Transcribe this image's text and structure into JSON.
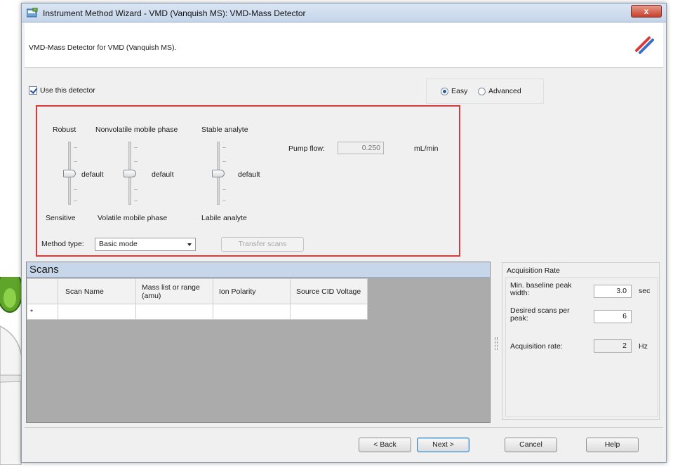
{
  "window": {
    "title": "Instrument Method Wizard - VMD (Vanquish MS): VMD-Mass Detector",
    "close_label": "x",
    "subtitle": "VMD-Mass Detector for VMD (Vanquish MS)."
  },
  "detector": {
    "use_label": "Use this detector",
    "use_checked": true
  },
  "mode": {
    "options": [
      "Easy",
      "Advanced"
    ],
    "selected": "Easy"
  },
  "sliders": [
    {
      "top_label": "Robust",
      "bottom_label": "Sensitive",
      "value_label": "default"
    },
    {
      "top_label": "Nonvolatile mobile phase",
      "bottom_label": "Volatile mobile phase",
      "value_label": "default"
    },
    {
      "top_label": "Stable analyte",
      "bottom_label": "Labile analyte",
      "value_label": "default"
    }
  ],
  "pump_flow": {
    "label": "Pump flow:",
    "value": "0.250",
    "unit": "mL/min"
  },
  "method_type": {
    "label": "Method type:",
    "selected": "Basic mode"
  },
  "transfer_button": "Transfer scans",
  "scans": {
    "title": "Scans",
    "columns": [
      "Scan Name",
      "Mass list or range (amu)",
      "Ion Polarity",
      "Source CID Voltage"
    ],
    "new_row_marker": "*"
  },
  "acquisition": {
    "title": "Acquisition Rate",
    "min_baseline_label": "Min. baseline peak width:",
    "min_baseline_value": "3.0",
    "min_baseline_unit": "sec",
    "desired_scans_label": "Desired scans per peak:",
    "desired_scans_value": "6",
    "rate_label": "Acquisition rate:",
    "rate_value": "2",
    "rate_unit": "Hz"
  },
  "footer": {
    "back": "< Back",
    "next": "Next >",
    "cancel": "Cancel",
    "help": "Help"
  }
}
